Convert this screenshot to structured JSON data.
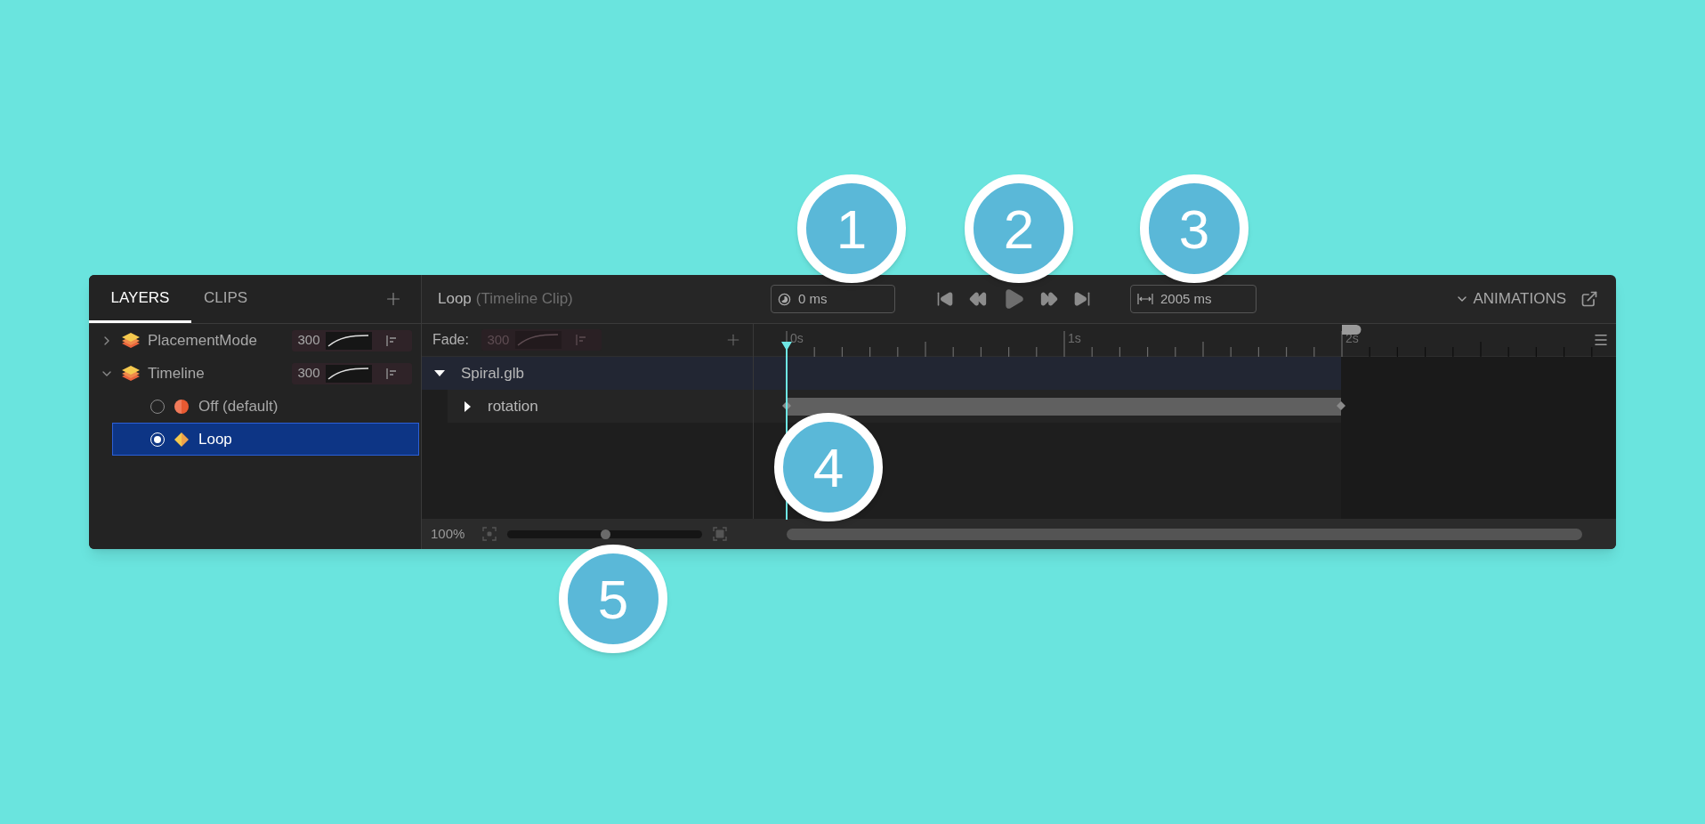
{
  "left_panel": {
    "tabs": [
      {
        "label": "LAYERS",
        "selected": true
      },
      {
        "label": "CLIPS",
        "selected": false
      }
    ],
    "layers": [
      {
        "name": "PlacementMode",
        "expanded": false,
        "fade": {
          "value": "300",
          "disabled": false
        }
      },
      {
        "name": "Timeline",
        "expanded": true,
        "fade": {
          "value": "300",
          "disabled": false
        },
        "children": [
          {
            "name": "Off (default)",
            "kind": "off",
            "selected": false
          },
          {
            "name": "Loop",
            "kind": "loop",
            "selected": true
          }
        ]
      }
    ]
  },
  "clip_header": {
    "title": "Loop",
    "subtitle": "(Timeline Clip)",
    "time": "0 ms",
    "duration": "2005 ms",
    "animations": "ANIMATIONS"
  },
  "fade": {
    "label": "Fade:",
    "value": "300",
    "disabled": true
  },
  "ruler": {
    "labels": [
      "0s",
      "1s",
      "2s"
    ]
  },
  "tracks": [
    {
      "name": "Spiral.glb",
      "expanded": true,
      "children": [
        {
          "name": "rotation",
          "expanded": false
        }
      ]
    }
  ],
  "zoom": {
    "reading": "100%",
    "level": 0.5
  },
  "callouts": [
    "1",
    "2",
    "3",
    "4",
    "5"
  ]
}
